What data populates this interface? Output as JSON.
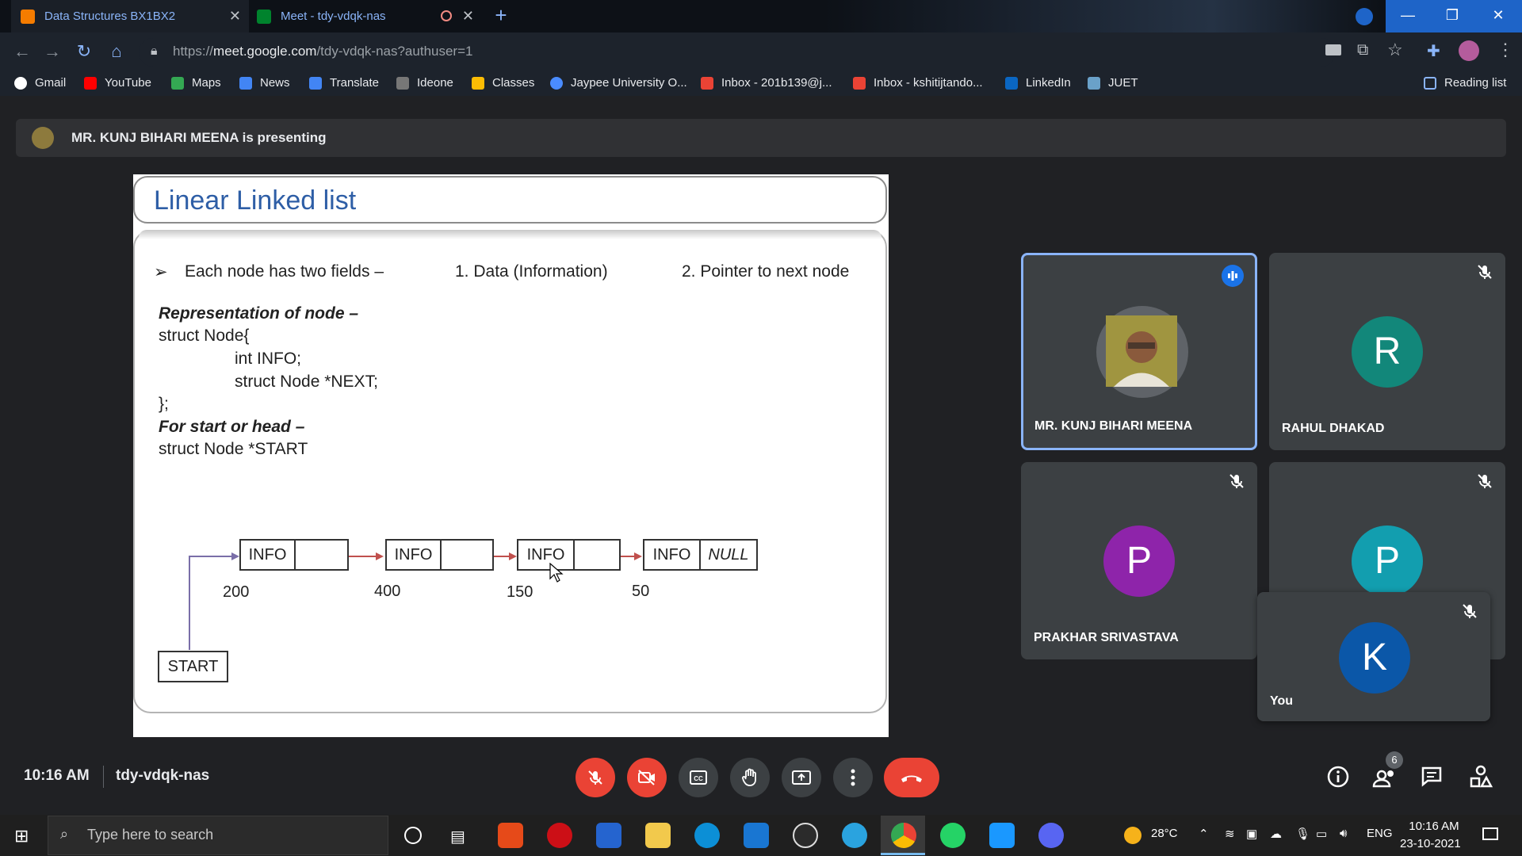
{
  "browser": {
    "tabs": [
      {
        "title": "Data Structures BX1BX2",
        "favicon_color": "#f57c00"
      },
      {
        "title": "Meet - tdy-vdqk-nas",
        "favicon_color": "#00832d"
      }
    ],
    "url_prefix": "https://",
    "url_host": "meet.google.com",
    "url_path": "/tdy-vdqk-nas?authuser=1",
    "bookmarks": [
      "Gmail",
      "YouTube",
      "Maps",
      "News",
      "Translate",
      "Ideone",
      "Classes",
      "Jaypee University O...",
      "Inbox - 201b139@j...",
      "Inbox - kshitijtando...",
      "LinkedIn",
      "JUET"
    ],
    "reading_list": "Reading list"
  },
  "meet": {
    "presenting_banner": "MR. KUNJ BIHARI MEENA is presenting",
    "time": "10:16 AM",
    "meeting_code": "tdy-vdqk-nas",
    "people_count": "6"
  },
  "slide": {
    "title": "Linear Linked list",
    "bullet_marker": "➢",
    "bullet": "Each node has two fields –",
    "field1": "1.  Data (Information)",
    "field2": "2. Pointer to next node",
    "rep_heading": "Representation of node –",
    "code_lines": [
      "struct Node{",
      "int INFO;",
      "struct Node *NEXT;",
      "};"
    ],
    "head_heading": "For start or head –",
    "head_code": "struct Node *START",
    "diagram": {
      "nodes": [
        {
          "data": "INFO",
          "next": "",
          "address": "200"
        },
        {
          "data": "INFO",
          "next": "",
          "address": "400"
        },
        {
          "data": "INFO",
          "next": "",
          "address": "150"
        },
        {
          "data": "INFO",
          "next": "NULL",
          "address": "50"
        }
      ],
      "start_label": "START"
    }
  },
  "participants": [
    {
      "name": "MR. KUNJ BIHARI MEENA",
      "initial": "",
      "color": "#6b6b3a",
      "speaking": true
    },
    {
      "name": "RAHUL DHAKAD",
      "initial": "R",
      "color": "#12877a",
      "speaking": false
    },
    {
      "name": "PRAKHAR SRIVASTAVA",
      "initial": "P",
      "color": "#8e24aa",
      "speaking": false
    },
    {
      "name": "",
      "initial": "P",
      "color": "#129eaf",
      "speaking": false
    },
    {
      "name": "You",
      "initial": "K",
      "color": "#0b57a8",
      "speaking": false
    }
  ],
  "taskbar": {
    "search_placeholder": "Type here to search",
    "weather": "28°C",
    "language": "ENG",
    "clock_time": "10:16 AM",
    "clock_date": "23-10-2021"
  }
}
